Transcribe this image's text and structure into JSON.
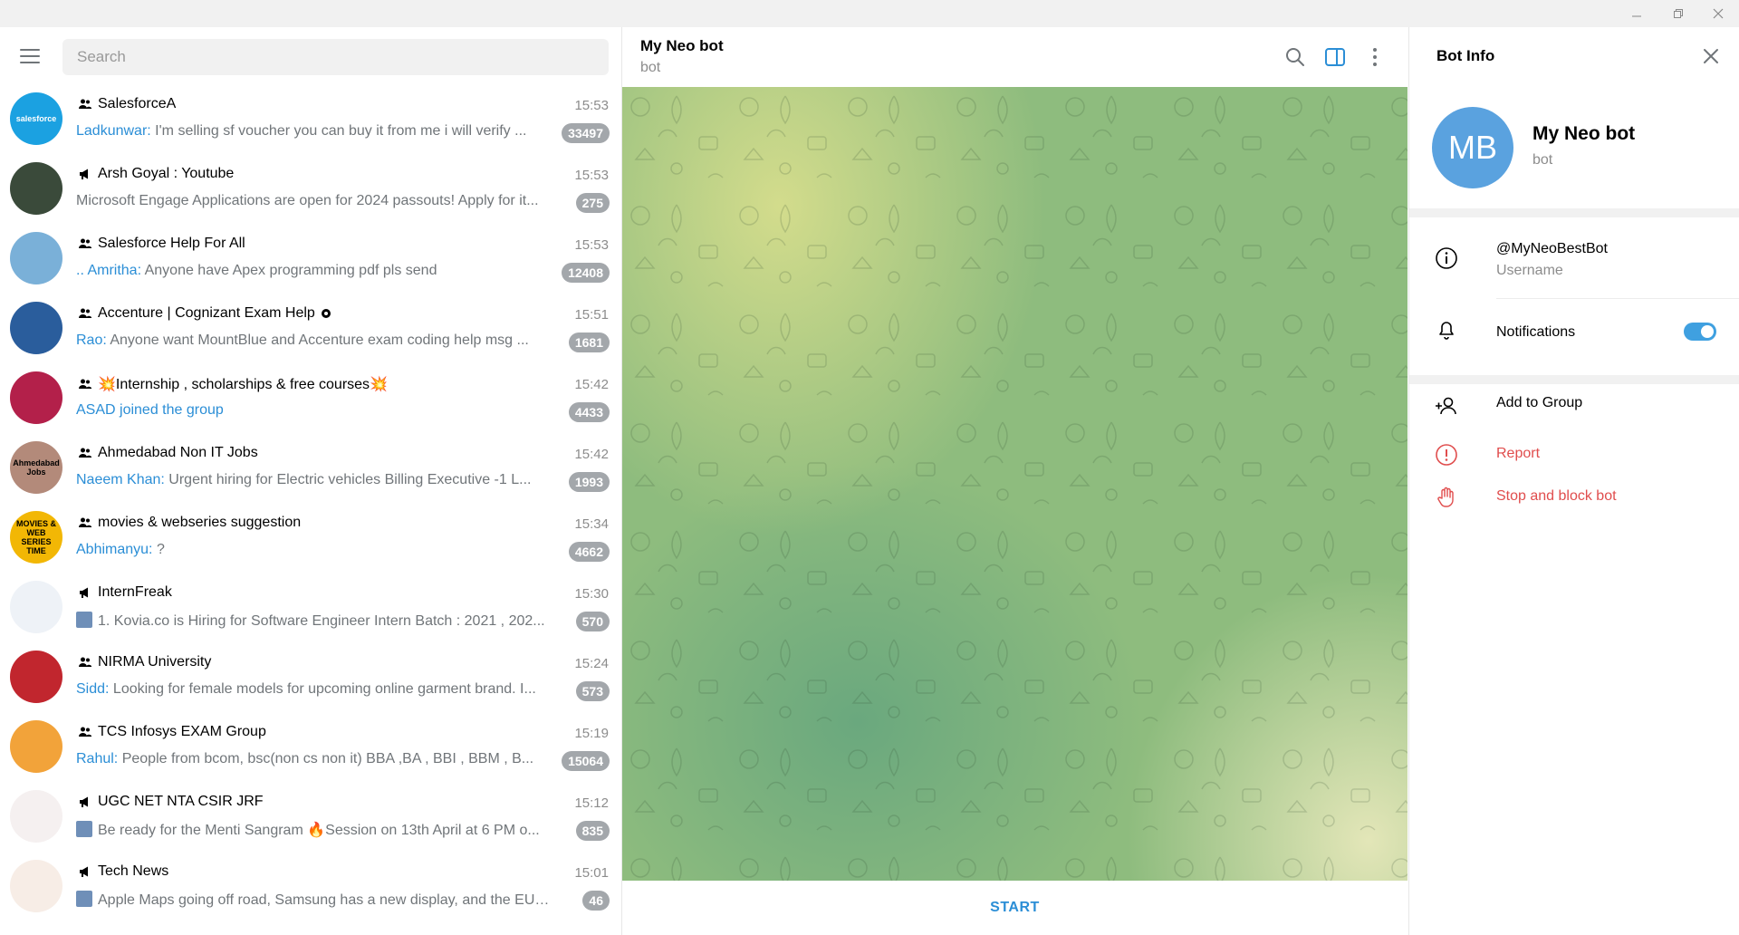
{
  "window": {
    "minimize_icon": "minimize-icon",
    "maximize_icon": "restore-icon",
    "close_icon": "close-icon"
  },
  "search": {
    "placeholder": "Search"
  },
  "chats": [
    {
      "title": "SalesforceA",
      "type": "group",
      "time": "15:53",
      "sender": "Ladkunwar:",
      "preview": " I'm selling sf voucher you can buy it from me i will verify ...",
      "badge": "33497"
    },
    {
      "title": "Arsh Goyal : Youtube",
      "type": "channel",
      "time": "15:53",
      "sender": "",
      "preview": "Microsoft Engage Applications are open for 2024 passouts!  Apply for it...",
      "badge": "275"
    },
    {
      "title": "Salesforce Help For All",
      "type": "group",
      "time": "15:53",
      "sender": ".. Amritha:",
      "preview": " Anyone have Apex programming pdf pls send",
      "badge": "12408"
    },
    {
      "title": "Accenture | Cognizant Exam Help",
      "type": "group",
      "time": "15:51",
      "sender": "Rao:",
      "preview": " Anyone want MountBlue and Accenture exam coding help msg ...",
      "badge": "1681"
    },
    {
      "title": "💥Internship , scholarships & free courses💥",
      "type": "group",
      "time": "15:42",
      "sender": "ASAD joined the group",
      "preview": "",
      "badge": "4433"
    },
    {
      "title": "Ahmedabad Non IT Jobs",
      "type": "group",
      "time": "15:42",
      "sender": "Naeem Khan:",
      "preview": " Urgent hiring for Electric vehicles   Billing Executive -1   L...",
      "badge": "1993"
    },
    {
      "title": "movies & webseries suggestion",
      "type": "group",
      "time": "15:34",
      "sender": "Abhimanyu:",
      "preview": " ?",
      "badge": "4662"
    },
    {
      "title": "InternFreak",
      "type": "channel",
      "time": "15:30",
      "sender": "",
      "preview": "1. Kovia.co is Hiring for Software Engineer Intern Batch : 2021 , 202...",
      "badge": "570"
    },
    {
      "title": "NIRMA University",
      "type": "group",
      "time": "15:24",
      "sender": "Sidd:",
      "preview": " Looking for female models for upcoming online garment brand. I...",
      "badge": "573"
    },
    {
      "title": "TCS Infosys EXAM Group",
      "type": "group",
      "time": "15:19",
      "sender": "Rahul:",
      "preview": " People from bcom,  bsc(non cs non it) BBA ,BA , BBI , BBM , B...",
      "badge": "15064"
    },
    {
      "title": "UGC NET NTA CSIR JRF",
      "type": "channel",
      "time": "15:12",
      "sender": "",
      "preview": "Be ready for the Menti Sangram 🔥Session on 13th April at 6 PM o...",
      "badge": "835"
    },
    {
      "title": "Tech News",
      "type": "channel",
      "time": "15:01",
      "sender": "",
      "preview": "Apple Maps going off road, Samsung has a new display, and the EU l...",
      "badge": "46"
    }
  ],
  "avatar_texts": {
    "salesforce": "salesforce",
    "ahmedabad": "Ahmedabad Jobs",
    "movies": "MOVIES & WEB SERIES TIME"
  },
  "chat": {
    "title": "My Neo bot",
    "subtitle": "bot",
    "start_label": "START"
  },
  "info": {
    "title": "Bot Info",
    "initials": "MB",
    "name": "My Neo bot",
    "subtitle": "bot",
    "username": "@MyNeoBestBot",
    "username_label": "Username",
    "notifications_label": "Notifications",
    "notifications_on": true,
    "add_to_group": "Add to Group",
    "report": "Report",
    "stop_block": "Stop and block bot"
  },
  "colors": {
    "accent": "#2b8ed6",
    "danger": "#e04d4d",
    "badge": "#a3a7ab",
    "avatar_mb": "#5aa2df"
  }
}
